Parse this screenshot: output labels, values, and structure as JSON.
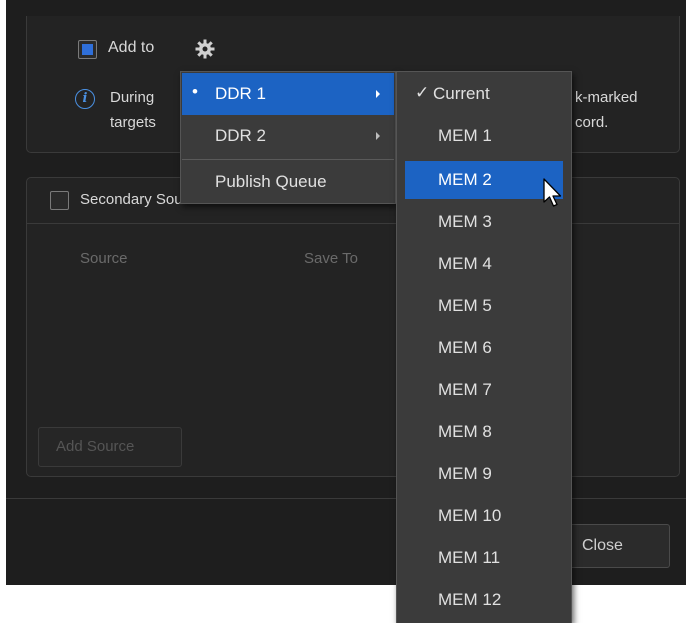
{
  "record_panel": {
    "add_to_label": "Add to",
    "add_to_checked": true,
    "info_line1": "During",
    "info_line1_tail": "k-marked",
    "info_line2": "targets",
    "info_line2_tail": "cord."
  },
  "secondary_panel": {
    "title": "Secondary Sources",
    "checked": false,
    "col_source": "Source",
    "col_save_to": "Save To",
    "add_source_label": "Add Source"
  },
  "footer": {
    "close_label": "Close"
  },
  "menu_main": {
    "items": [
      {
        "label": "DDR 1",
        "bullet": "•",
        "has_submenu": true,
        "selected": true
      },
      {
        "label": "DDR 2",
        "has_submenu": true,
        "selected": false
      },
      {
        "label": "Publish Queue",
        "has_submenu": false,
        "selected": false
      }
    ]
  },
  "menu_sub": {
    "items": [
      {
        "label": "Current",
        "check": "✓",
        "checked": true
      },
      {
        "label": "MEM 1"
      },
      {
        "label": "MEM 2",
        "hover": true
      },
      {
        "label": "MEM 3"
      },
      {
        "label": "MEM 4"
      },
      {
        "label": "MEM 5"
      },
      {
        "label": "MEM 6"
      },
      {
        "label": "MEM 7"
      },
      {
        "label": "MEM 8"
      },
      {
        "label": "MEM 9"
      },
      {
        "label": "MEM 10"
      },
      {
        "label": "MEM 11"
      },
      {
        "label": "MEM 12"
      }
    ]
  },
  "icons": {
    "gear": "gear-icon",
    "info": "info-icon",
    "cursor": "mouse-pointer-icon"
  },
  "colors": {
    "accent": "#1c63c3",
    "checkbox_fill": "#2f6fd9",
    "info": "#4a90e2"
  }
}
